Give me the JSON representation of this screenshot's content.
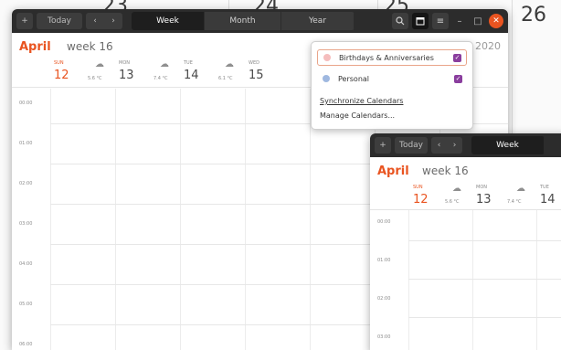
{
  "background": {
    "day_numbers": [
      "23",
      "24",
      "25",
      "26"
    ]
  },
  "window_main": {
    "toolbar": {
      "today_label": "Today",
      "views": [
        "Week",
        "Month",
        "Year"
      ],
      "icons": [
        "plus-icon",
        "chevron-left-icon",
        "chevron-right-icon",
        "search-icon",
        "calendar-icon",
        "menu-icon",
        "minimize-icon",
        "maximize-icon",
        "close-icon"
      ]
    },
    "header": {
      "month": "April",
      "week": "week 16",
      "year_partial": "2020"
    },
    "days": [
      {
        "name": "SUN",
        "number": "12",
        "temp": ""
      },
      {
        "name": "MON",
        "number": "13",
        "temp": "5.6 °C"
      },
      {
        "name": "TUE",
        "number": "14",
        "temp": "7.4 °C"
      },
      {
        "name": "WED",
        "number": "15",
        "temp": "6.1 °C"
      }
    ],
    "hours": [
      "00:00",
      "01:00",
      "02:00",
      "03:00",
      "04:00",
      "05:00",
      "06:00"
    ]
  },
  "popover": {
    "calendars": [
      {
        "name": "Birthdays & Anniversaries",
        "color": "#f5bdbd",
        "checked": true
      },
      {
        "name": "Personal",
        "color": "#9fb8e0",
        "checked": true
      }
    ],
    "links": [
      "Synchronize Calendars",
      "Manage Calendars..."
    ]
  },
  "window_second": {
    "toolbar": {
      "today_label": "Today",
      "views": [
        "Week"
      ]
    },
    "header": {
      "month": "April",
      "week": "week 16"
    },
    "days": [
      {
        "name": "SUN",
        "number": "12",
        "temp": ""
      },
      {
        "name": "MON",
        "number": "13",
        "temp": "5.6 °C"
      },
      {
        "name": "TUE",
        "number": "14",
        "temp": "7.4 °C"
      }
    ],
    "hours": [
      "00:00",
      "01:00",
      "02:00",
      "03:00"
    ]
  },
  "colors": {
    "accent": "#e95420",
    "titlebar": "#2c2c2c",
    "checkbox": "#8a3e9e"
  }
}
